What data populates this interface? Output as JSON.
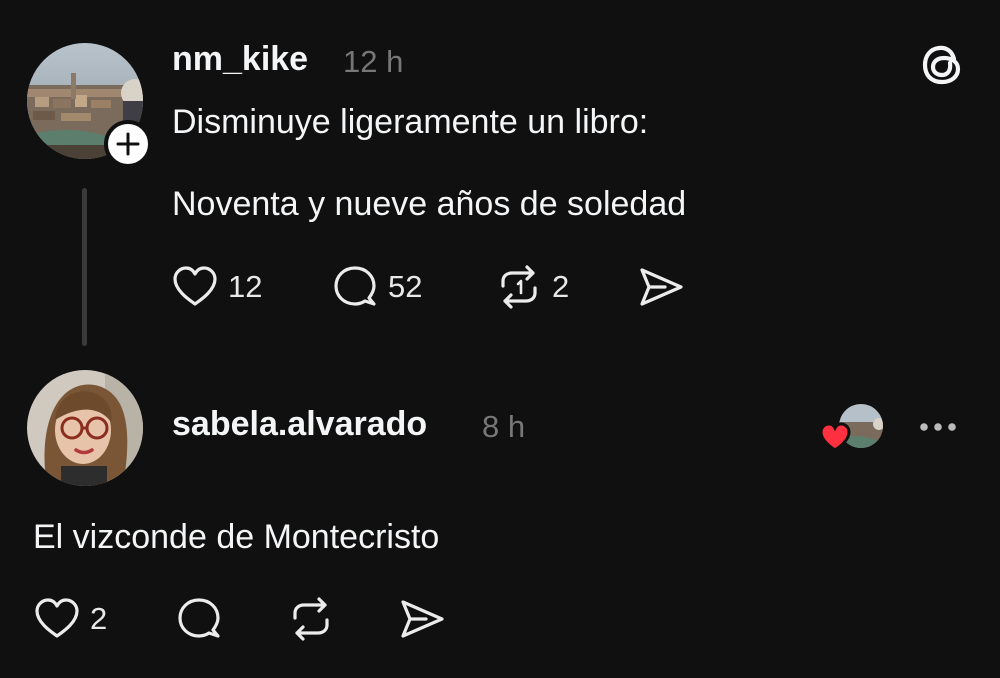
{
  "post": {
    "username": "nm_kike",
    "time": "12 h",
    "text_line1": "Disminuye ligeramente un libro:",
    "text_line2": "Noventa y nueve años de soledad",
    "actions": {
      "likes": "12",
      "replies": "52",
      "reposts": "2"
    }
  },
  "reply": {
    "username": "sabela.alvarado",
    "time": "8 h",
    "text": "El vizconde de Montecristo",
    "actions": {
      "likes": "2"
    }
  },
  "icons": {
    "logo": "threads-logo-icon",
    "like": "heart-icon",
    "reply": "comment-icon",
    "repost": "repost-icon",
    "share": "send-icon",
    "follow": "plus-icon",
    "more": "more-horizontal-icon",
    "liked_by_author": "red-heart-icon"
  },
  "colors": {
    "background": "#101010",
    "text": "#f3f5f7",
    "secondary_text": "#777777",
    "heart_red": "#ff3040"
  }
}
